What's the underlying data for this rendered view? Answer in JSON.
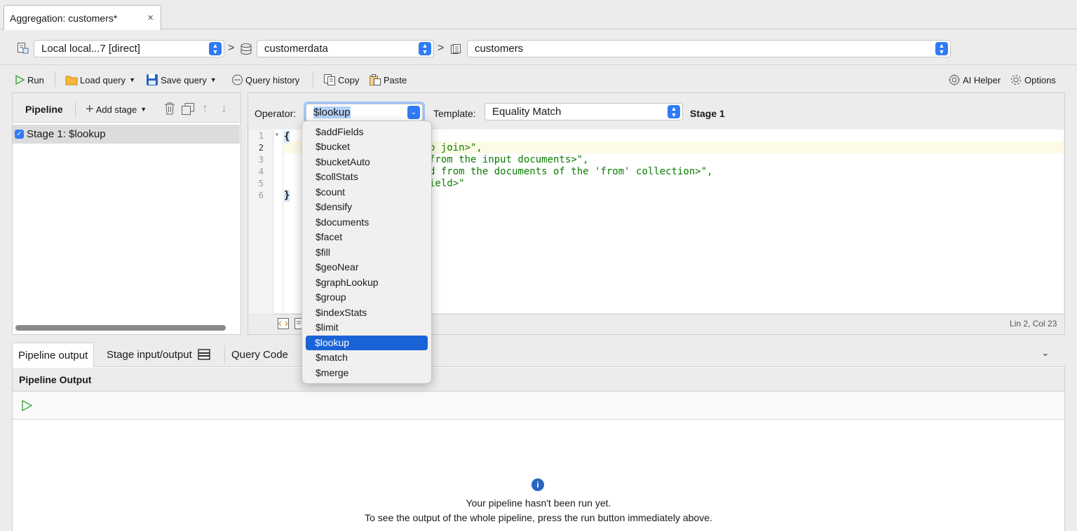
{
  "tab": {
    "title": "Aggregation: customers*",
    "close": "×"
  },
  "path": {
    "connection": "Local local...7 [direct]",
    "database": "customerdata",
    "collection": "customers",
    "separator": ">"
  },
  "toolbar": {
    "run": "Run",
    "load_query": "Load query",
    "save_query": "Save query",
    "query_history": "Query history",
    "copy": "Copy",
    "paste": "Paste",
    "ai_helper": "AI Helper",
    "options": "Options"
  },
  "pipeline": {
    "title": "Pipeline",
    "add_stage": "Add stage",
    "stages": [
      {
        "label": "Stage 1: $lookup",
        "checked": true
      }
    ]
  },
  "stage_editor": {
    "operator_label": "Operator:",
    "operator_value": "$lookup",
    "template_label": "Template:",
    "template_value": "Equality Match",
    "stage_title": "Stage 1",
    "line_numbers": [
      "1",
      "2",
      "3",
      "4",
      "5",
      "6"
    ],
    "code_lines": [
      "{",
      "o join>\",",
      "from the input documents>\",",
      "d from the documents of the 'from' collection>\",",
      "ield>\"",
      "}"
    ],
    "cursor_status": "Lin 2, Col 23"
  },
  "operator_options": [
    "$addFields",
    "$bucket",
    "$bucketAuto",
    "$collStats",
    "$count",
    "$densify",
    "$documents",
    "$facet",
    "$fill",
    "$geoNear",
    "$graphLookup",
    "$group",
    "$indexStats",
    "$limit",
    "$lookup",
    "$match",
    "$merge"
  ],
  "operator_selected": "$lookup",
  "output": {
    "tabs": [
      "Pipeline output",
      "Stage input/output",
      "Query Code"
    ],
    "active_tab": "Pipeline output",
    "header": "Pipeline Output",
    "message_line1": "Your pipeline hasn't been run yet.",
    "message_line2": "To see the output of the whole pipeline, press the run button immediately above."
  },
  "colors": {
    "accent": "#2f7bf5",
    "selection": "#1a63d6",
    "code_string": "#0a7d00",
    "run_green": "#3aa93a"
  }
}
